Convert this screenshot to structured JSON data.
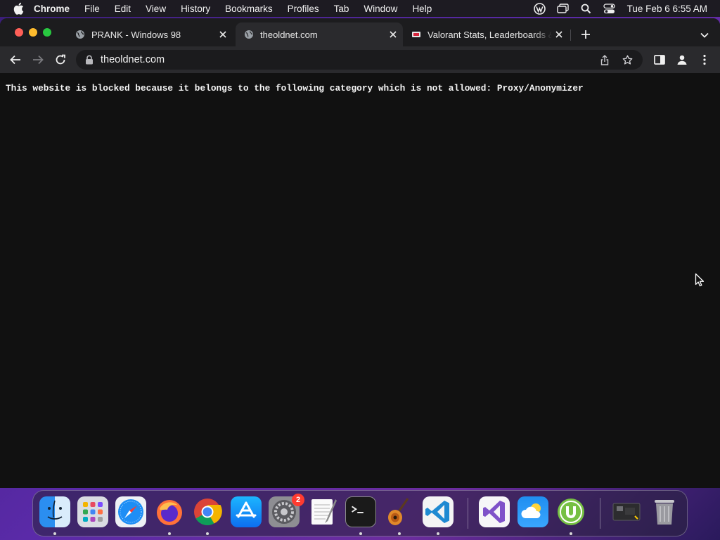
{
  "menubar": {
    "app_name": "Chrome",
    "items": [
      "File",
      "Edit",
      "View",
      "History",
      "Bookmarks",
      "Profiles",
      "Tab",
      "Window",
      "Help"
    ],
    "clock": "Tue Feb 6  6:55 AM",
    "status_icons": [
      "wordpress-icon",
      "screen-mirroring-icon",
      "spotlight-search-icon",
      "control-center-icon"
    ]
  },
  "tabs": [
    {
      "title": "PRANK - Windows 98",
      "favicon": "globe-icon",
      "active": false
    },
    {
      "title": "theoldnet.com",
      "favicon": "globe-icon",
      "active": true
    },
    {
      "title": "Valorant Stats, Leaderboards &",
      "favicon": "tracker-icon",
      "active": false
    }
  ],
  "toolbar": {
    "url": "theoldnet.com"
  },
  "page": {
    "message": "This website is blocked because it belongs to the following category which is not allowed: Proxy/Anonymizer"
  },
  "dock": {
    "apps": [
      "Finder",
      "Launchpad",
      "Safari",
      "Firefox",
      "Google Chrome",
      "App Store",
      "System Preferences",
      "TextEdit",
      "Terminal",
      "GarageBand",
      "Visual Studio Code",
      "Visual Studio",
      "Weather",
      "uTorrent",
      "Screenshot",
      "Trash"
    ],
    "system_preferences_badge": "2"
  },
  "colors": {
    "page_bg": "#111111",
    "chrome_toolbar": "#2a2a2d",
    "tabstrip": "#1c1c1e",
    "badge": "#ff3b30"
  }
}
